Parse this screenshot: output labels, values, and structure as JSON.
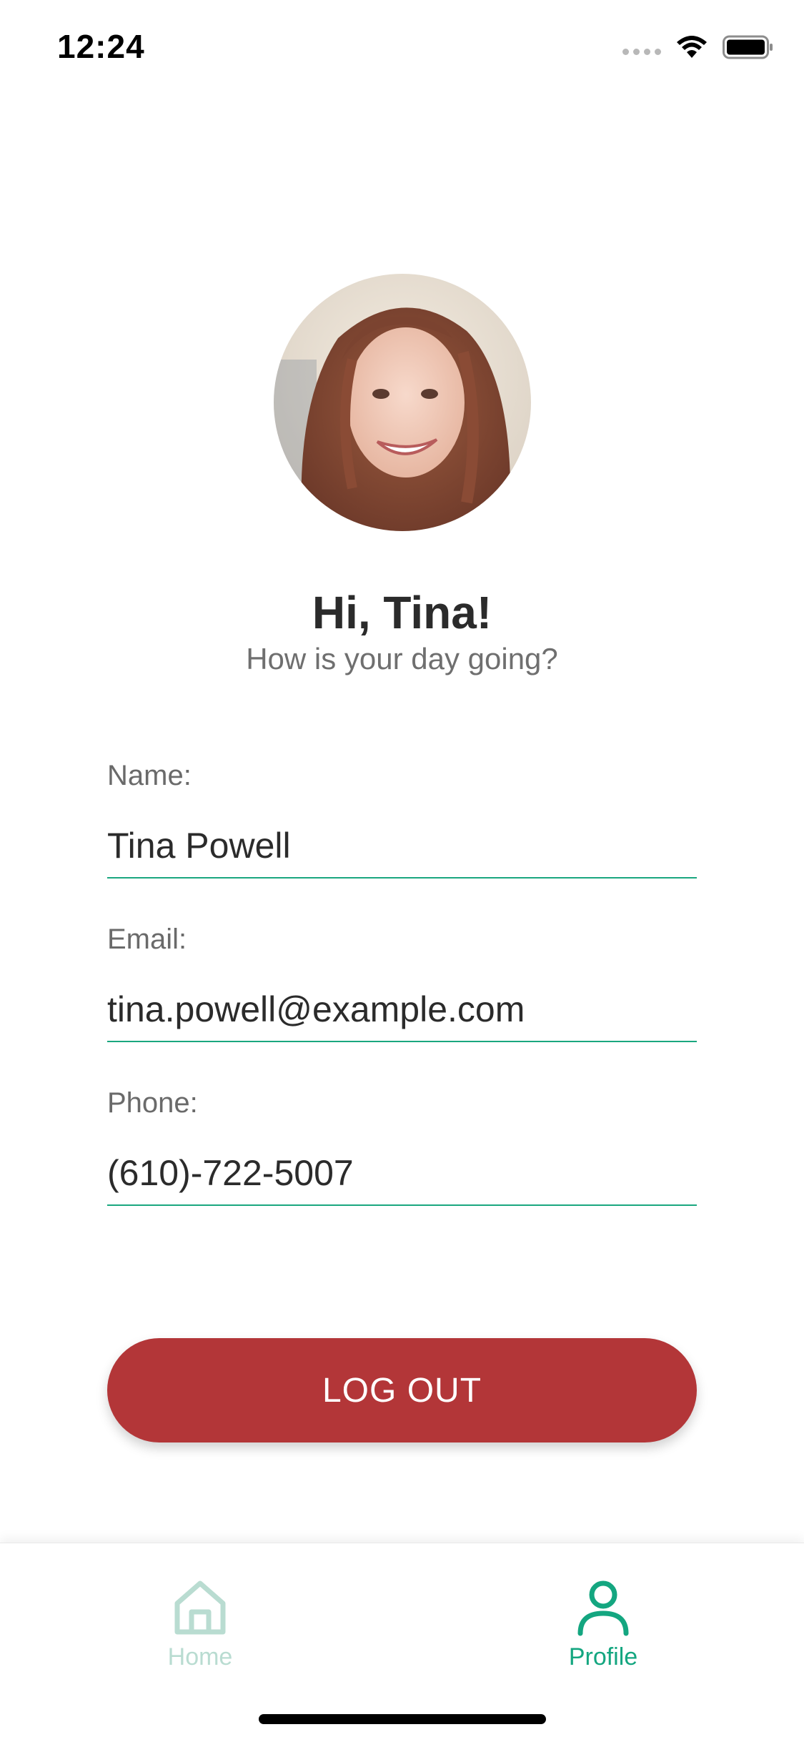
{
  "status_bar": {
    "time": "12:24"
  },
  "profile": {
    "avatar_alt": "profile-photo",
    "greeting": "Hi, Tina!",
    "subtitle": "How is your day going?"
  },
  "fields": {
    "name": {
      "label": "Name:",
      "value": "Tina Powell"
    },
    "email": {
      "label": "Email:",
      "value": "tina.powell@example.com"
    },
    "phone": {
      "label": "Phone:",
      "value": "(610)-722-5007"
    }
  },
  "actions": {
    "logout_label": "LOG OUT"
  },
  "tabs": [
    {
      "label": "Home",
      "icon": "home-icon",
      "active": false
    },
    {
      "label": "Profile",
      "icon": "person-icon",
      "active": true
    }
  ],
  "colors": {
    "accent": "#14a680",
    "accent_muted": "#b9dcd1",
    "danger": "#b33638",
    "underline": "#1aa77f"
  }
}
